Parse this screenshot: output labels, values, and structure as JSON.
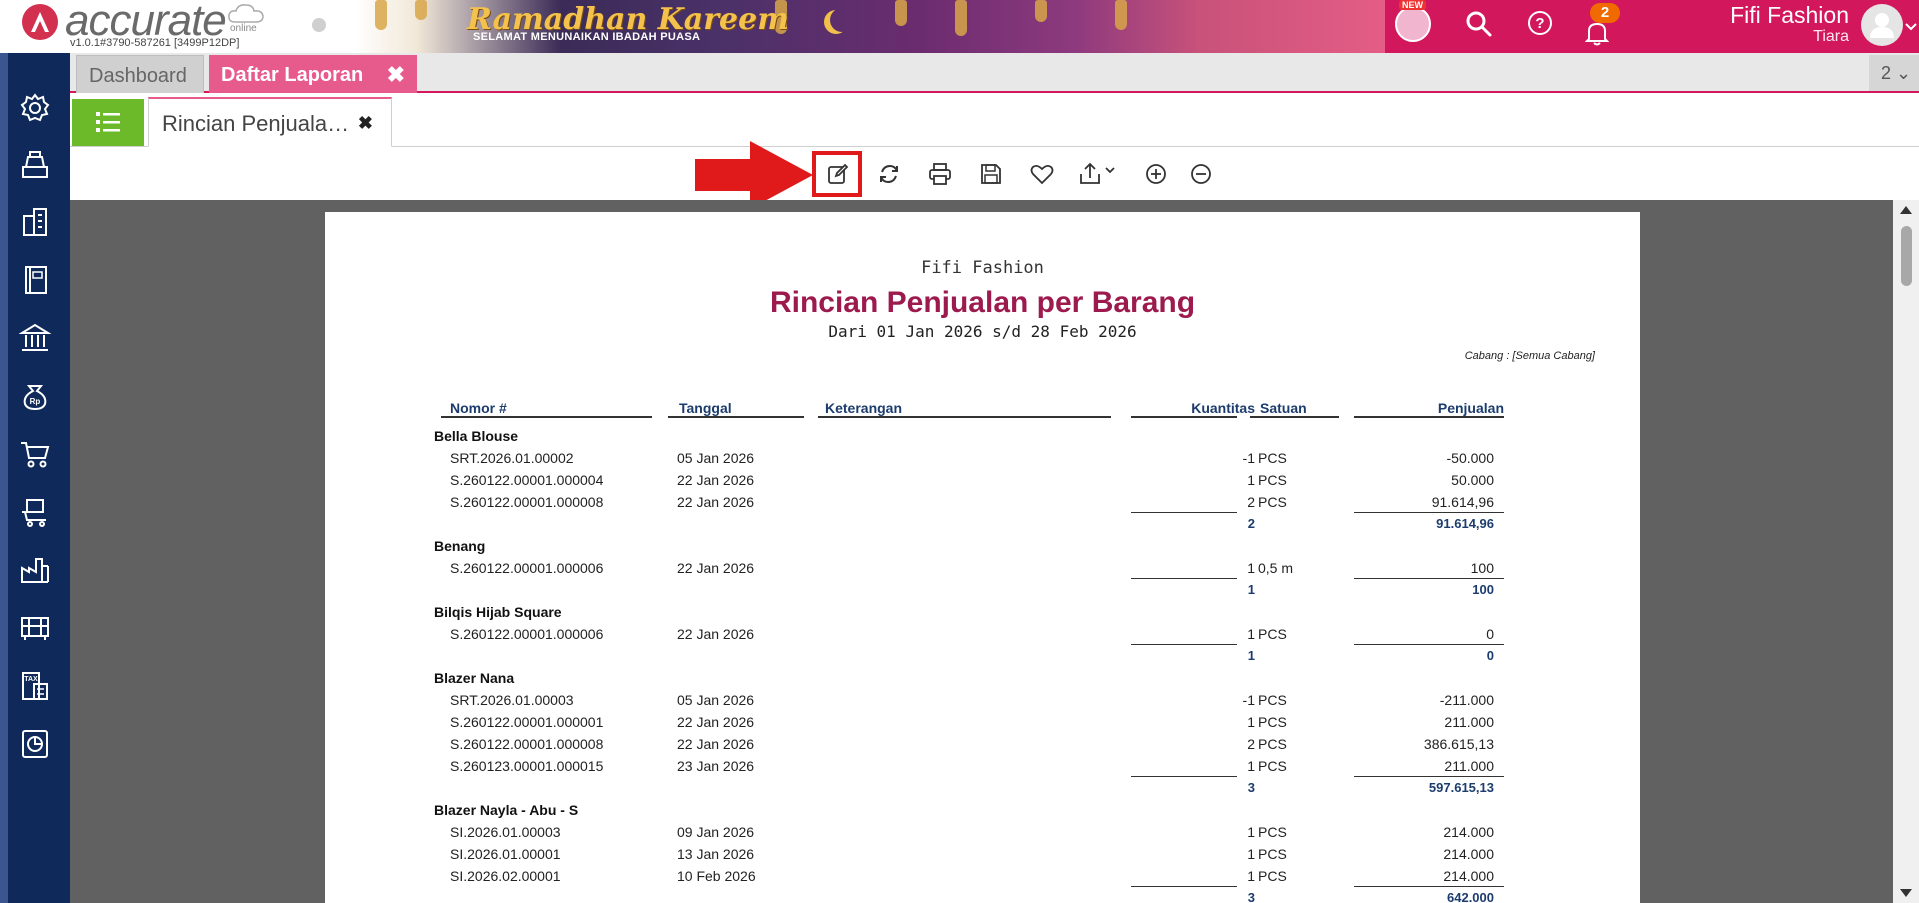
{
  "header": {
    "logo_text": "accurate",
    "logo_online": "online",
    "version": "v1.0.1#3790-587261 [3499P12DP]",
    "banner_title": "Ramadhan Kareem",
    "banner_subtitle": "SELAMAT MENUNAIKAN IBADAH PUASA",
    "new_badge": "NEW",
    "notification_count": "2",
    "company_name": "Fifi Fashion",
    "user_name": "Tiara",
    "brand_color": "#d3175c"
  },
  "sidebar": {
    "items": [
      {
        "icon": "gear-icon"
      },
      {
        "icon": "cash-register-icon"
      },
      {
        "icon": "building-icon"
      },
      {
        "icon": "book-icon"
      },
      {
        "icon": "bank-icon"
      },
      {
        "icon": "money-bag-icon"
      },
      {
        "icon": "shopping-cart-icon"
      },
      {
        "icon": "warehouse-cart-icon"
      },
      {
        "icon": "factory-icon"
      },
      {
        "icon": "inventory-icon"
      },
      {
        "icon": "tax-document-icon"
      },
      {
        "icon": "report-chart-icon"
      }
    ]
  },
  "tabs": {
    "dashboard": "Dashboard",
    "daftar_laporan": "Daftar Laporan",
    "close_symbol": "✖",
    "count": "2 ⌄"
  },
  "subtabs": {
    "report_tab": "Rincian Penjuala…",
    "close_symbol": "✖"
  },
  "toolbar": {
    "icons": [
      "edit-icon",
      "refresh-icon",
      "print-icon",
      "save-icon",
      "favorite-icon",
      "export-icon",
      "zoom-in-icon",
      "zoom-out-icon"
    ]
  },
  "report": {
    "company": "Fifi Fashion",
    "title": "Rincian Penjualan per Barang",
    "period": "Dari 01 Jan 2026 s/d 28 Feb 2026",
    "branch": "Cabang : [Semua Cabang]",
    "columns": {
      "nomor": "Nomor #",
      "tanggal": "Tanggal",
      "keterangan": "Keterangan",
      "kuantitas": "Kuantitas",
      "satuan": "Satuan",
      "penjualan": "Penjualan"
    },
    "groups": [
      {
        "name": "Bella Blouse",
        "rows": [
          {
            "no": "SRT.2026.01.00002",
            "date": "05 Jan 2026",
            "qty": "-1",
            "unit": "PCS",
            "amount": "-50.000"
          },
          {
            "no": "S.260122.00001.000004",
            "date": "22 Jan 2026",
            "qty": "1",
            "unit": "PCS",
            "amount": "50.000"
          },
          {
            "no": "S.260122.00001.000008",
            "date": "22 Jan 2026",
            "qty": "2",
            "unit": "PCS",
            "amount": "91.614,96"
          }
        ],
        "total_qty": "2",
        "total_amount": "91.614,96"
      },
      {
        "name": "Benang",
        "rows": [
          {
            "no": "S.260122.00001.000006",
            "date": "22 Jan 2026",
            "qty": "1",
            "unit": "0,5 m",
            "amount": "100"
          }
        ],
        "total_qty": "1",
        "total_amount": "100"
      },
      {
        "name": "Bilqis Hijab Square",
        "rows": [
          {
            "no": "S.260122.00001.000006",
            "date": "22 Jan 2026",
            "qty": "1",
            "unit": "PCS",
            "amount": "0"
          }
        ],
        "total_qty": "1",
        "total_amount": "0"
      },
      {
        "name": "Blazer Nana",
        "rows": [
          {
            "no": "SRT.2026.01.00003",
            "date": "05 Jan 2026",
            "qty": "-1",
            "unit": "PCS",
            "amount": "-211.000"
          },
          {
            "no": "S.260122.00001.000001",
            "date": "22 Jan 2026",
            "qty": "1",
            "unit": "PCS",
            "amount": "211.000"
          },
          {
            "no": "S.260122.00001.000008",
            "date": "22 Jan 2026",
            "qty": "2",
            "unit": "PCS",
            "amount": "386.615,13"
          },
          {
            "no": "S.260123.00001.000015",
            "date": "23 Jan 2026",
            "qty": "1",
            "unit": "PCS",
            "amount": "211.000"
          }
        ],
        "total_qty": "3",
        "total_amount": "597.615,13"
      },
      {
        "name": "Blazer Nayla - Abu - S",
        "rows": [
          {
            "no": "SI.2026.01.00003",
            "date": "09 Jan 2026",
            "qty": "1",
            "unit": "PCS",
            "amount": "214.000"
          },
          {
            "no": "SI.2026.01.00001",
            "date": "13 Jan 2026",
            "qty": "1",
            "unit": "PCS",
            "amount": "214.000"
          },
          {
            "no": "SI.2026.02.00001",
            "date": "10 Feb 2026",
            "qty": "1",
            "unit": "PCS",
            "amount": "214.000"
          }
        ],
        "total_qty": "3",
        "total_amount": "642.000"
      }
    ]
  }
}
